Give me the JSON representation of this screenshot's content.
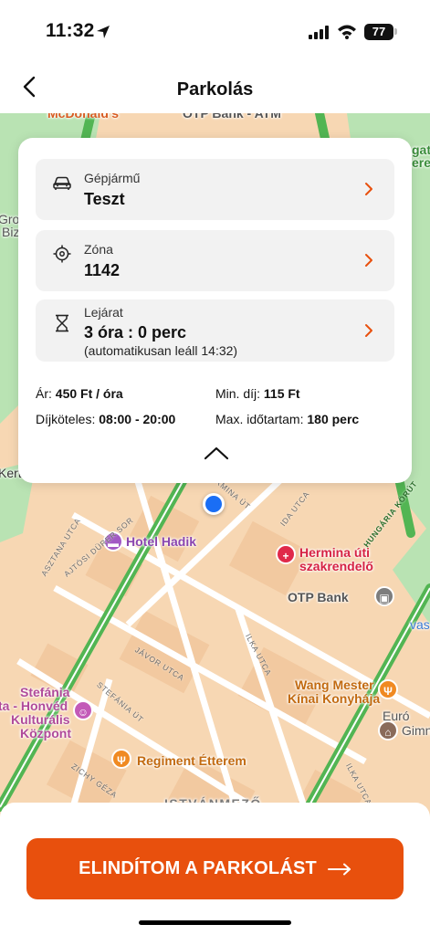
{
  "status_bar": {
    "time": "11:32",
    "battery": "77"
  },
  "nav": {
    "title": "Parkolás"
  },
  "card": {
    "vehicle": {
      "label": "Gépjármű",
      "value": "Teszt"
    },
    "zone": {
      "label": "Zóna",
      "value": "1142"
    },
    "expiry": {
      "label": "Lejárat",
      "value": "3 óra : 0 perc",
      "sub": "(automatikusan leáll 14:32)"
    },
    "info": {
      "price_label": "Ár:",
      "price_value": "450 Ft / óra",
      "min_fee_label": "Min. díj:",
      "min_fee_value": "115 Ft",
      "paid_hours_label": "Díjköteles:",
      "paid_hours_value": "08:00 - 20:00",
      "max_duration_label": "Max. időtartam:",
      "max_duration_value": "180 perc"
    }
  },
  "map": {
    "labels": {
      "mcdonalds": "McDonald's",
      "otp_atm": "OTP Bank - ATM",
      "hotel_hadik": "Hotel Hadik",
      "hermina_1": "Hermina úti",
      "hermina_2": "szakrendelő",
      "otp_bank": "OTP Bank",
      "wang_1": "Wang Mester",
      "wang_2": "Kínai Konyhája",
      "stefania_1": "Stefánia",
      "stefania_2": "ta - Honvéd",
      "stefania_3": "Kulturális",
      "stefania_4": "Központ",
      "regiment": "Regiment Étterem",
      "euro_1": "Euró",
      "euro_2": "Gimn",
      "istvanmezo": "ISTVÁNMEZŐ",
      "kerty": "Kert",
      "grou": "Grou",
      "biz": "Biz",
      "gat": "gat",
      "erer": "erer",
      "vas": "vas"
    },
    "streets": {
      "asztana": "ASZTANA UTCA",
      "ajtosi": "AJTÓSI DÜRER SOR",
      "ida": "IDA UTCA",
      "hungaria": "HUNGÁRIA KÖRÚT",
      "javor": "JÁVOR UTCA",
      "ilka1": "ILKA UTCA",
      "ilka2": "ILKA UTCA",
      "stefania_ut": "STEFÁNIA ÚT",
      "zichy": "ZICHY GÉZA",
      "hermina_ut": "ERMINA ÚT"
    }
  },
  "cta": {
    "label": "ELINDÍTOM A PARKOLÁST"
  },
  "colors": {
    "accent": "#e8500d",
    "card_row": "#f2f2f2",
    "map_block": "#f7d7b3",
    "park": "#b9e3b3",
    "road_green": "#52b553"
  }
}
